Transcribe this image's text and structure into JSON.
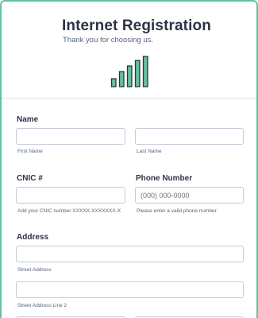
{
  "header": {
    "title": "Internet Registration",
    "subtitle": "Thank you for choosing us.",
    "icon": "signal-bars-icon",
    "accent_color": "#64c19f"
  },
  "form": {
    "name": {
      "label": "Name",
      "first_sublabel": "First Name",
      "last_sublabel": "Last Name",
      "first_value": "",
      "last_value": ""
    },
    "cnic": {
      "label": "CNIC #",
      "value": "",
      "sublabel": "Add your CNIC number XXXXX-XXXXXXX-X"
    },
    "phone": {
      "label": "Phone Number",
      "placeholder": "(000) 000-0000",
      "sublabel": "Please enter a valid phone number."
    },
    "address": {
      "label": "Address",
      "street_sublabel": "Street Address",
      "street2_sublabel": "Street Address Line 2",
      "street_value": "",
      "street2_value": ""
    }
  }
}
